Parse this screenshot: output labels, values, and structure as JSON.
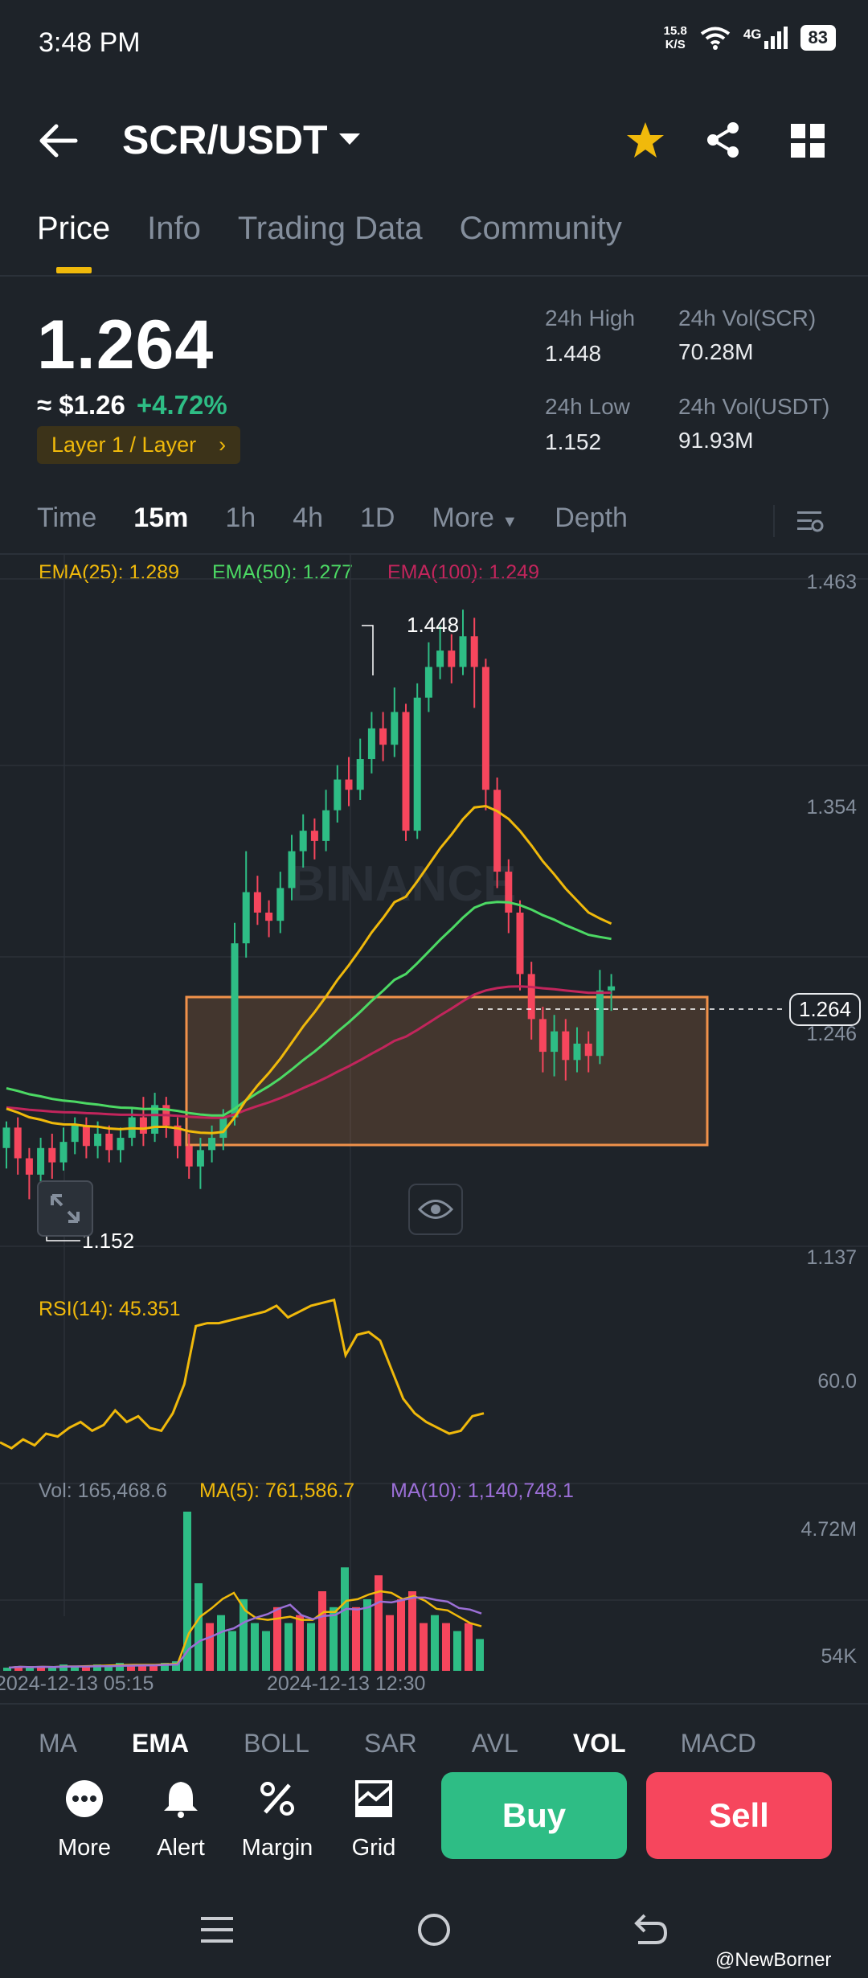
{
  "status": {
    "time": "3:48 PM",
    "net_speed_value": "15.8",
    "net_speed_unit": "K/S",
    "network": "4G",
    "battery": "83"
  },
  "header": {
    "pair": "SCR/USDT"
  },
  "tabs": [
    "Price",
    "Info",
    "Trading Data",
    "Community"
  ],
  "ticker": {
    "last_price": "1.264",
    "usd_price": "≈ $1.26",
    "change": "+4.72%",
    "tag": "Layer 1 / Layer",
    "high_label": "24h High",
    "high": "1.448",
    "low_label": "24h Low",
    "low": "1.152",
    "vol_base_label": "24h Vol(SCR)",
    "vol_base": "70.28M",
    "vol_quote_label": "24h Vol(USDT)",
    "vol_quote": "91.93M"
  },
  "timeframes": [
    "Time",
    "15m",
    "1h",
    "4h",
    "1D",
    "More",
    "Depth"
  ],
  "active_timeframe": "15m",
  "ema_legend": {
    "ema25": "EMA(25): 1.289",
    "ema50": "EMA(50): 1.277",
    "ema100": "EMA(100): 1.249"
  },
  "colors": {
    "up": "#2ebd85",
    "down": "#f6465d",
    "ema25": "#f0b90b",
    "ema50": "#4cd964",
    "ema100": "#c2255c",
    "accent": "#f0b90b",
    "ma10": "#9b6fd6"
  },
  "price_axis": [
    "1.463",
    "1.354",
    "1.246",
    "1.137"
  ],
  "current_price_label": "1.264",
  "high_marker": "1.448",
  "low_marker": "1.152",
  "watermark": "BINANCE",
  "rsi": {
    "label": "RSI(14): 45.351",
    "axis": "60.0"
  },
  "volume": {
    "vol_label": "Vol: 165,468.6",
    "ma5_label": "MA(5): 761,586.7",
    "ma10_label": "MA(10): 1,140,748.1",
    "axis_top": "4.72M",
    "axis_bottom": "54K"
  },
  "time_axis": [
    "2024-12-13 05:15",
    "2024-12-13 12:30"
  ],
  "indicators": [
    "MA",
    "EMA",
    "BOLL",
    "SAR",
    "AVL",
    "VOL",
    "MACD"
  ],
  "active_main_indicator": "EMA",
  "active_sub_indicator": "VOL",
  "actions": [
    "More",
    "Alert",
    "Margin",
    "Grid"
  ],
  "buttons": {
    "buy": "Buy",
    "sell": "Sell"
  },
  "credit": "@NewBorner",
  "chart_data": {
    "type": "candlestick",
    "title": "SCR/USDT 15m",
    "price_range": [
      1.137,
      1.463
    ],
    "high": 1.448,
    "low": 1.152,
    "last": 1.264,
    "candles": [
      {
        "o": 1.185,
        "c": 1.195,
        "h": 1.198,
        "l": 1.175
      },
      {
        "o": 1.195,
        "c": 1.18,
        "h": 1.2,
        "l": 1.172
      },
      {
        "o": 1.18,
        "c": 1.172,
        "h": 1.185,
        "l": 1.16
      },
      {
        "o": 1.172,
        "c": 1.185,
        "h": 1.19,
        "l": 1.152
      },
      {
        "o": 1.185,
        "c": 1.178,
        "h": 1.192,
        "l": 1.17
      },
      {
        "o": 1.178,
        "c": 1.188,
        "h": 1.195,
        "l": 1.174
      },
      {
        "o": 1.188,
        "c": 1.196,
        "h": 1.2,
        "l": 1.182
      },
      {
        "o": 1.196,
        "c": 1.186,
        "h": 1.2,
        "l": 1.18
      },
      {
        "o": 1.186,
        "c": 1.192,
        "h": 1.198,
        "l": 1.18
      },
      {
        "o": 1.192,
        "c": 1.184,
        "h": 1.196,
        "l": 1.178
      },
      {
        "o": 1.184,
        "c": 1.19,
        "h": 1.195,
        "l": 1.178
      },
      {
        "o": 1.19,
        "c": 1.2,
        "h": 1.205,
        "l": 1.186
      },
      {
        "o": 1.2,
        "c": 1.192,
        "h": 1.21,
        "l": 1.186
      },
      {
        "o": 1.192,
        "c": 1.206,
        "h": 1.212,
        "l": 1.188
      },
      {
        "o": 1.206,
        "c": 1.196,
        "h": 1.21,
        "l": 1.19
      },
      {
        "o": 1.196,
        "c": 1.186,
        "h": 1.2,
        "l": 1.18
      },
      {
        "o": 1.186,
        "c": 1.176,
        "h": 1.192,
        "l": 1.17
      },
      {
        "o": 1.176,
        "c": 1.184,
        "h": 1.19,
        "l": 1.165
      },
      {
        "o": 1.184,
        "c": 1.19,
        "h": 1.196,
        "l": 1.178
      },
      {
        "o": 1.19,
        "c": 1.2,
        "h": 1.204,
        "l": 1.184
      },
      {
        "o": 1.2,
        "c": 1.285,
        "h": 1.295,
        "l": 1.196
      },
      {
        "o": 1.285,
        "c": 1.31,
        "h": 1.33,
        "l": 1.278
      },
      {
        "o": 1.31,
        "c": 1.3,
        "h": 1.318,
        "l": 1.294
      },
      {
        "o": 1.3,
        "c": 1.296,
        "h": 1.306,
        "l": 1.288
      },
      {
        "o": 1.296,
        "c": 1.312,
        "h": 1.32,
        "l": 1.29
      },
      {
        "o": 1.312,
        "c": 1.33,
        "h": 1.338,
        "l": 1.306
      },
      {
        "o": 1.33,
        "c": 1.34,
        "h": 1.348,
        "l": 1.322
      },
      {
        "o": 1.34,
        "c": 1.335,
        "h": 1.346,
        "l": 1.326
      },
      {
        "o": 1.335,
        "c": 1.35,
        "h": 1.36,
        "l": 1.33
      },
      {
        "o": 1.35,
        "c": 1.365,
        "h": 1.372,
        "l": 1.344
      },
      {
        "o": 1.365,
        "c": 1.36,
        "h": 1.376,
        "l": 1.352
      },
      {
        "o": 1.36,
        "c": 1.375,
        "h": 1.385,
        "l": 1.355
      },
      {
        "o": 1.375,
        "c": 1.39,
        "h": 1.398,
        "l": 1.368
      },
      {
        "o": 1.39,
        "c": 1.382,
        "h": 1.398,
        "l": 1.374
      },
      {
        "o": 1.382,
        "c": 1.398,
        "h": 1.41,
        "l": 1.376
      },
      {
        "o": 1.398,
        "c": 1.34,
        "h": 1.402,
        "l": 1.335
      },
      {
        "o": 1.34,
        "c": 1.405,
        "h": 1.412,
        "l": 1.336
      },
      {
        "o": 1.405,
        "c": 1.42,
        "h": 1.432,
        "l": 1.398
      },
      {
        "o": 1.42,
        "c": 1.428,
        "h": 1.44,
        "l": 1.414
      },
      {
        "o": 1.428,
        "c": 1.42,
        "h": 1.436,
        "l": 1.412
      },
      {
        "o": 1.42,
        "c": 1.435,
        "h": 1.448,
        "l": 1.416
      },
      {
        "o": 1.435,
        "c": 1.42,
        "h": 1.444,
        "l": 1.4
      },
      {
        "o": 1.42,
        "c": 1.36,
        "h": 1.424,
        "l": 1.35
      },
      {
        "o": 1.36,
        "c": 1.32,
        "h": 1.366,
        "l": 1.312
      },
      {
        "o": 1.32,
        "c": 1.3,
        "h": 1.326,
        "l": 1.29
      },
      {
        "o": 1.3,
        "c": 1.27,
        "h": 1.306,
        "l": 1.262
      },
      {
        "o": 1.27,
        "c": 1.248,
        "h": 1.276,
        "l": 1.238
      },
      {
        "o": 1.248,
        "c": 1.232,
        "h": 1.254,
        "l": 1.222
      },
      {
        "o": 1.232,
        "c": 1.242,
        "h": 1.25,
        "l": 1.22
      },
      {
        "o": 1.242,
        "c": 1.228,
        "h": 1.248,
        "l": 1.218
      },
      {
        "o": 1.228,
        "c": 1.236,
        "h": 1.244,
        "l": 1.222
      },
      {
        "o": 1.236,
        "c": 1.23,
        "h": 1.242,
        "l": 1.222
      },
      {
        "o": 1.23,
        "c": 1.262,
        "h": 1.272,
        "l": 1.226
      },
      {
        "o": 1.262,
        "c": 1.264,
        "h": 1.27,
        "l": 1.252
      }
    ],
    "rsi": [
      35,
      33,
      36,
      34,
      38,
      37,
      40,
      42,
      39,
      41,
      46,
      42,
      44,
      40,
      39,
      45,
      55,
      75,
      76,
      76,
      77,
      78,
      79,
      80,
      82,
      78,
      80,
      82,
      83,
      84,
      65,
      72,
      73,
      70,
      60,
      50,
      45,
      42,
      40,
      38,
      39,
      44,
      45
    ],
    "volume": [
      0.02,
      0.03,
      0.02,
      0.03,
      0.02,
      0.04,
      0.03,
      0.03,
      0.04,
      0.03,
      0.05,
      0.04,
      0.03,
      0.04,
      0.05,
      0.06,
      1.0,
      0.55,
      0.3,
      0.35,
      0.25,
      0.45,
      0.3,
      0.25,
      0.4,
      0.3,
      0.35,
      0.3,
      0.5,
      0.4,
      0.65,
      0.4,
      0.45,
      0.6,
      0.35,
      0.45,
      0.5,
      0.3,
      0.35,
      0.3,
      0.25,
      0.3,
      0.2
    ],
    "ylabel": "",
    "xlabel": ""
  }
}
